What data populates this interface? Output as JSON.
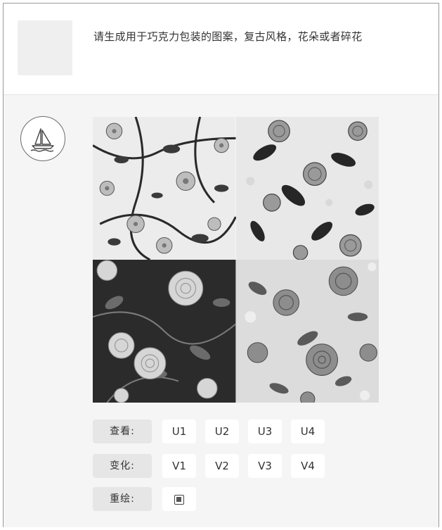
{
  "user": {
    "prompt": "请生成用于巧克力包装的图案，复古风格，花朵或者碎花"
  },
  "bot": {
    "avatar_icon": "sailboat-logo-icon",
    "image_icon": "floral-pattern-grid"
  },
  "actions": {
    "view_label": "查看:",
    "view_buttons": [
      "U1",
      "U2",
      "U3",
      "U4"
    ],
    "vary_label": "变化:",
    "vary_buttons": [
      "V1",
      "V2",
      "V3",
      "V4"
    ],
    "redraw_label": "重绘:",
    "redraw_icon": "redraw-icon"
  }
}
